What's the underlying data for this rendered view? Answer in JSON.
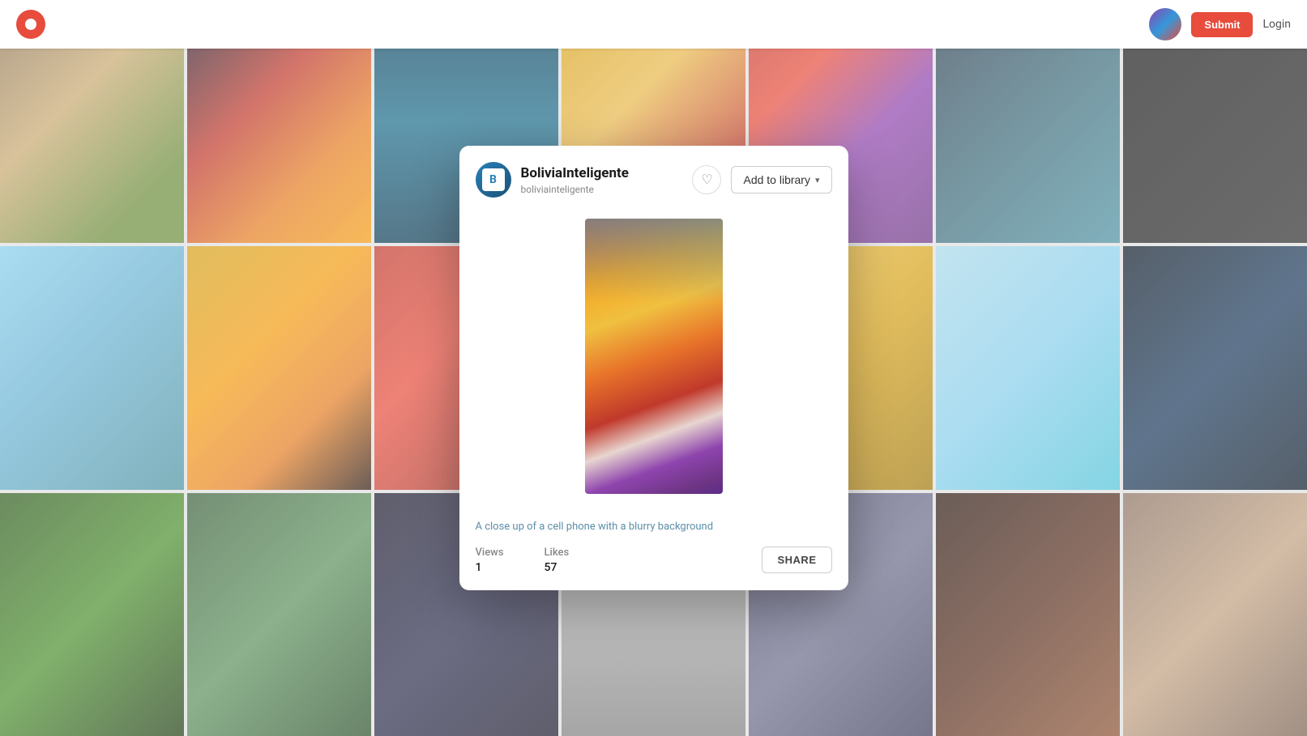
{
  "navbar": {
    "submit_label": "Submit",
    "login_label": "Login"
  },
  "modal": {
    "channel": {
      "name": "BoliviaInteligente",
      "handle": "boliviainteligente"
    },
    "add_library_label": "Add to library",
    "caption": "A close up of a cell phone with a blurry background",
    "stats": {
      "views_label": "Views",
      "views_value": "1",
      "likes_label": "Likes",
      "likes_value": "57"
    },
    "share_label": "SHARE"
  }
}
